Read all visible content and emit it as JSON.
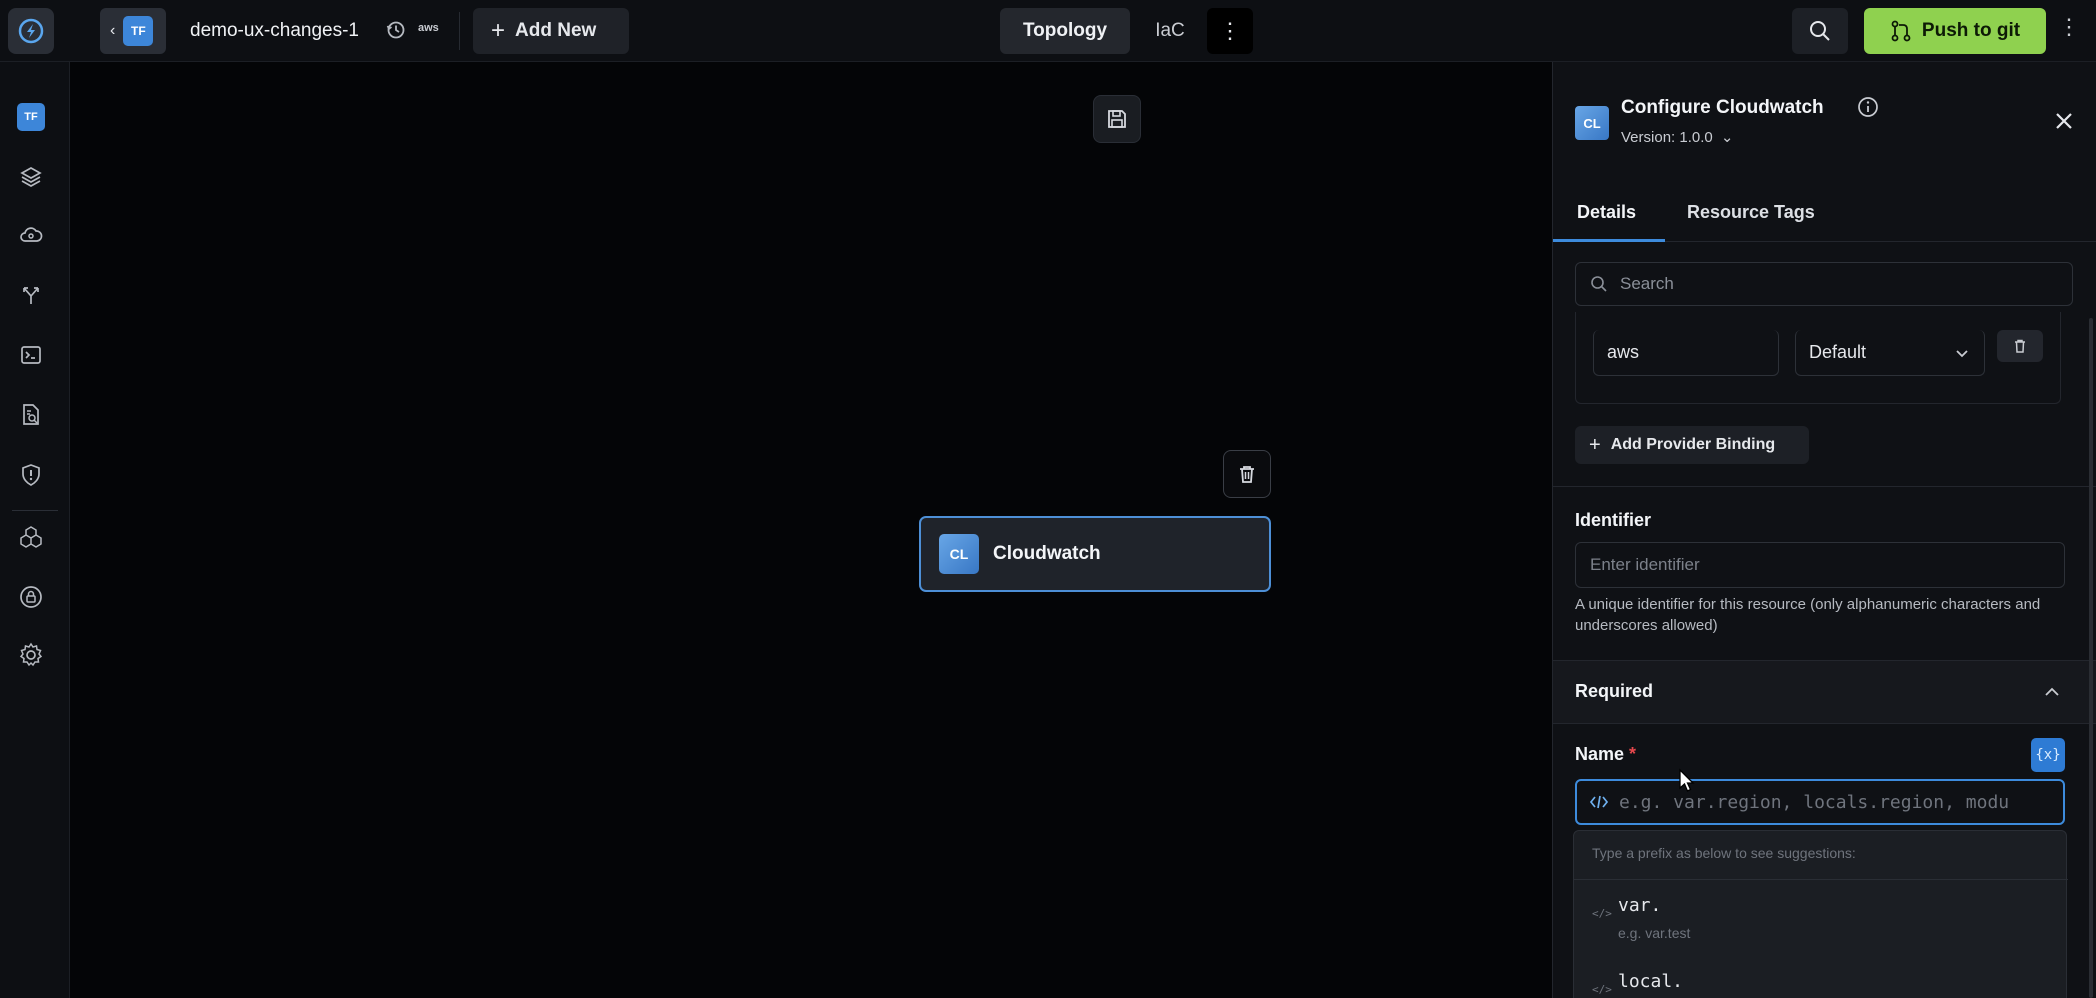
{
  "topbar": {
    "project_badge": "TF",
    "project_name": "demo-ux-changes-1",
    "provider_label": "aws",
    "add_new_label": "Add New",
    "tabs": [
      {
        "label": "Topology",
        "active": true
      },
      {
        "label": "IaC",
        "active": false
      }
    ],
    "push_label": "Push to git",
    "accent_color": "#8fd14f"
  },
  "leftrail": {
    "items": [
      {
        "icon": "terraform-badge-icon",
        "label": "TF"
      },
      {
        "icon": "layers-icon"
      },
      {
        "icon": "cloud-icon"
      },
      {
        "icon": "branch-icon"
      },
      {
        "icon": "terminal-icon"
      },
      {
        "icon": "document-search-icon"
      },
      {
        "icon": "shield-alert-icon"
      },
      {
        "icon": "modules-icon"
      },
      {
        "icon": "cloud-lock-icon"
      },
      {
        "icon": "gear-icon"
      }
    ]
  },
  "canvas": {
    "node": {
      "badge": "CL",
      "label": "Cloudwatch"
    }
  },
  "panel": {
    "badge": "CL",
    "title": "Configure Cloudwatch",
    "version": "Version: 1.0.0",
    "tabs": [
      {
        "label": "Details",
        "active": true
      },
      {
        "label": "Resource Tags",
        "active": false
      }
    ],
    "search_placeholder": "Search",
    "provider": {
      "value": "aws",
      "select": "Default"
    },
    "add_binding_label": "Add Provider Binding",
    "identifier": {
      "label": "Identifier",
      "placeholder": "Enter identifier",
      "help": "A unique identifier for this resource (only alphanumeric characters and underscores allowed)"
    },
    "required_section": "Required",
    "name_field": {
      "label": "Name",
      "required_mark": "*",
      "var_button": "{x}",
      "placeholder": "e.g. var.region, locals.region, modu"
    },
    "suggestions": {
      "hint": "Type a prefix as below to see suggestions:",
      "items": [
        {
          "name": "var.",
          "example": "e.g. var.test"
        },
        {
          "name": "local.",
          "example": ""
        }
      ]
    }
  }
}
